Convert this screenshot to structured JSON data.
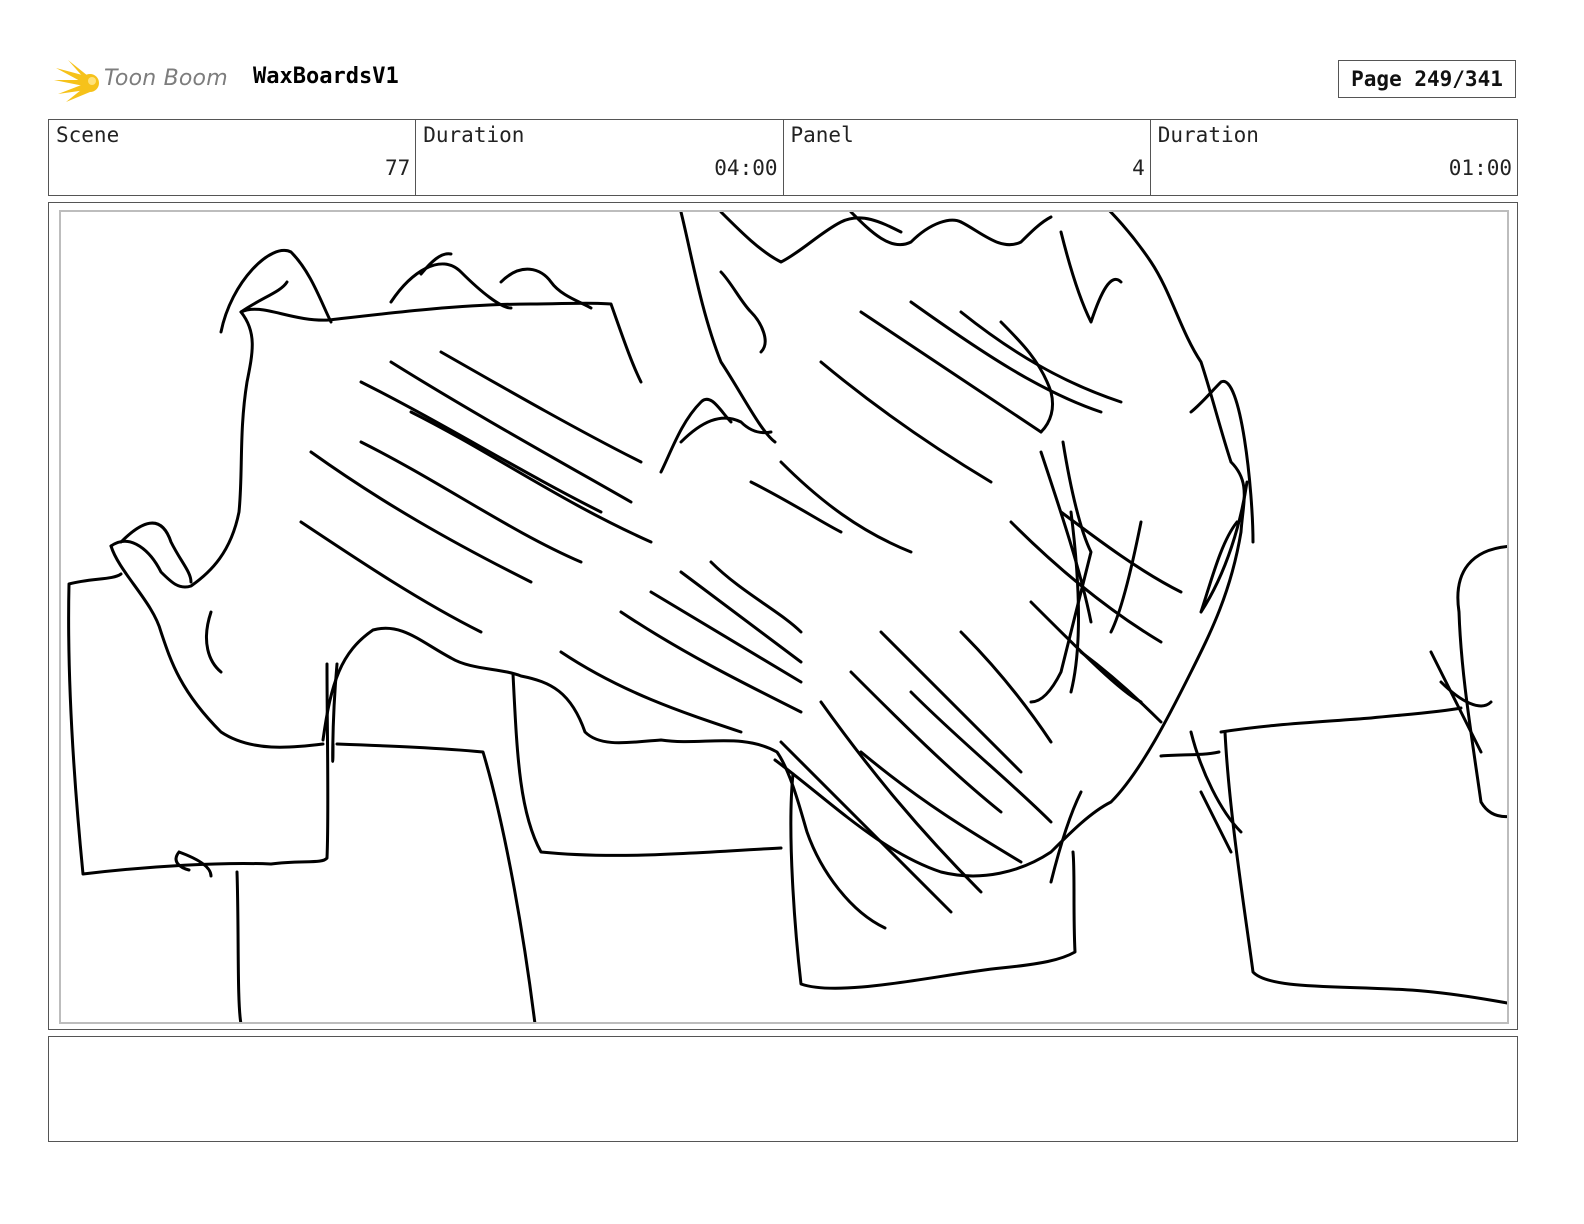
{
  "header": {
    "logo_text": "Toon Boom",
    "project_name": "WaxBoardsV1",
    "page_label": "Page 249/341"
  },
  "info": {
    "scene_label": "Scene",
    "scene_value": "77",
    "scene_duration_label": "Duration",
    "scene_duration_value": "04:00",
    "panel_label": "Panel",
    "panel_value": "4",
    "panel_duration_label": "Duration",
    "panel_duration_value": "01:00"
  },
  "colors": {
    "logo_star": "#f6c21a",
    "logo_text": "#7d7d7d",
    "frame_border": "#555555",
    "panel_inner_border": "#bdbdbd"
  },
  "notes": {
    "text": ""
  }
}
